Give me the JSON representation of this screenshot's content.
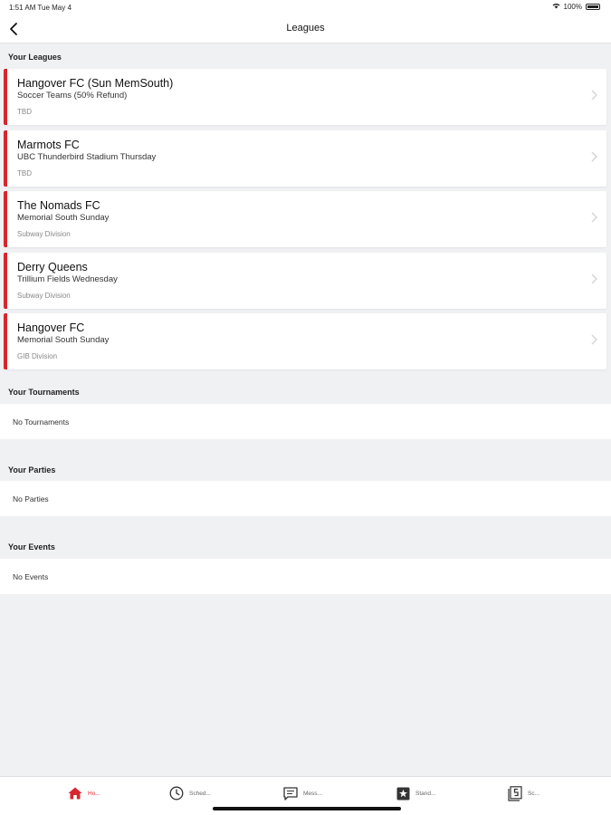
{
  "status": {
    "time_date": "1:51 AM   Tue May 4",
    "battery": "100%"
  },
  "nav": {
    "title": "Leagues"
  },
  "sections": {
    "leagues": "Your Leagues",
    "tournaments": "Your Tournaments",
    "parties": "Your Parties",
    "events": "Your Events"
  },
  "leagues": [
    {
      "name": "Hangover FC (Sun MemSouth)",
      "location": "Soccer Teams (50% Refund)",
      "division": "TBD"
    },
    {
      "name": "Marmots FC",
      "location": "UBC Thunderbird Stadium Thursday",
      "division": "TBD"
    },
    {
      "name": "The Nomads FC",
      "location": "Memorial South Sunday",
      "division": "Subway Division"
    },
    {
      "name": "Derry Queens",
      "location": "Trillium Fields Wednesday",
      "division": "Subway Division"
    },
    {
      "name": "Hangover FC",
      "location": "Memorial South Sunday",
      "division": "GIB Division"
    }
  ],
  "empty": {
    "tournaments": "No Tournaments",
    "parties": "No Parties",
    "events": "No Events"
  },
  "tabs": [
    {
      "label": "Ho...",
      "icon": "home-icon",
      "active": true
    },
    {
      "label": "Sched...",
      "icon": "clock-icon",
      "active": false
    },
    {
      "label": "Mess...",
      "icon": "message-icon",
      "active": false
    },
    {
      "label": "Stand...",
      "icon": "star-icon",
      "active": false
    },
    {
      "label": "Sc...",
      "icon": "scores-icon",
      "active": false
    }
  ],
  "colors": {
    "accent": "#d8262e",
    "background": "#f0f1f3",
    "card": "#ffffff"
  }
}
